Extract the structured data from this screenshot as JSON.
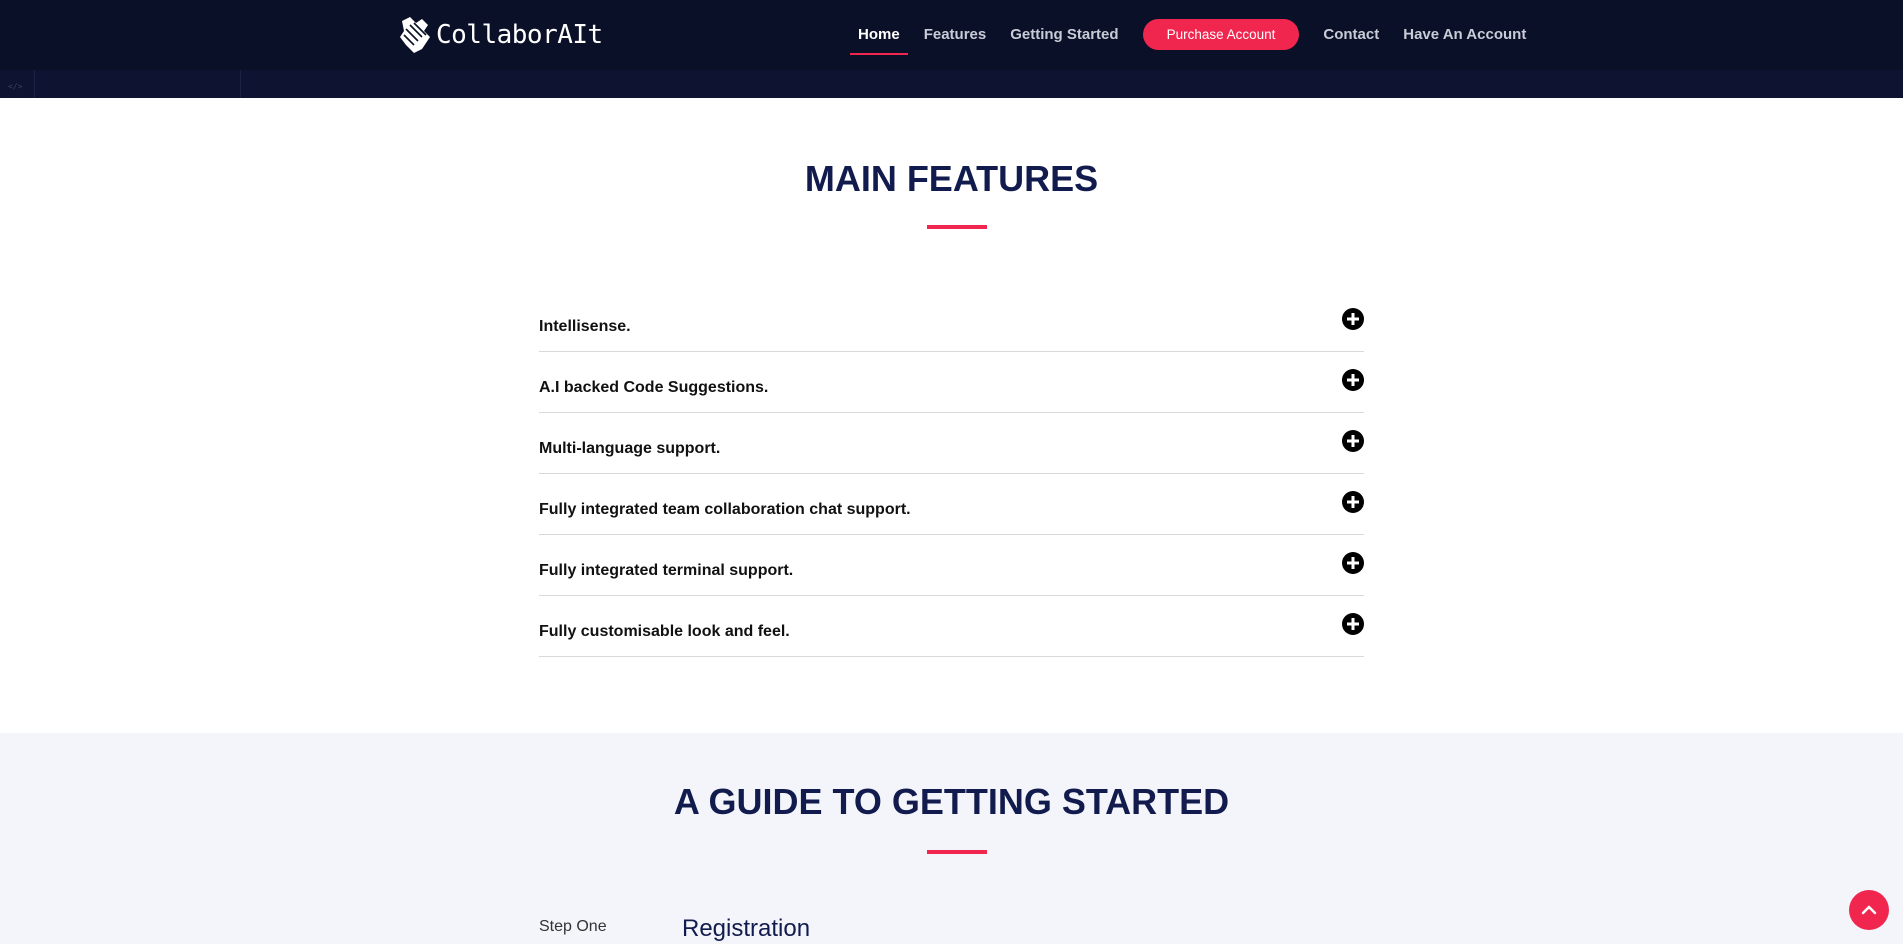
{
  "brand": {
    "name": "CollaborAIt"
  },
  "nav": {
    "items": [
      {
        "label": "Home",
        "active": true
      },
      {
        "label": "Features"
      },
      {
        "label": "Getting Started"
      }
    ],
    "cta": "Purchase Account",
    "items_after": [
      {
        "label": "Contact"
      },
      {
        "label": "Have An Account"
      }
    ]
  },
  "features": {
    "title": "MAIN FEATURES",
    "items": [
      "Intellisense.",
      "A.I backed Code Suggestions.",
      "Multi-language support.",
      "Fully integrated team collaboration chat support.",
      "Fully integrated terminal support.",
      "Fully customisable look and feel."
    ],
    "expand_icon": "plus-circle-icon"
  },
  "guide": {
    "title": "A GUIDE TO GETTING STARTED",
    "steps": [
      {
        "label": "Step One",
        "title": "Registration"
      }
    ]
  },
  "colors": {
    "header_bg": "#0b1029",
    "accent": "#f0264f",
    "heading": "#111b4d",
    "guide_bg": "#f4f5fa"
  },
  "back_to_top_icon": "chevron-up-icon"
}
